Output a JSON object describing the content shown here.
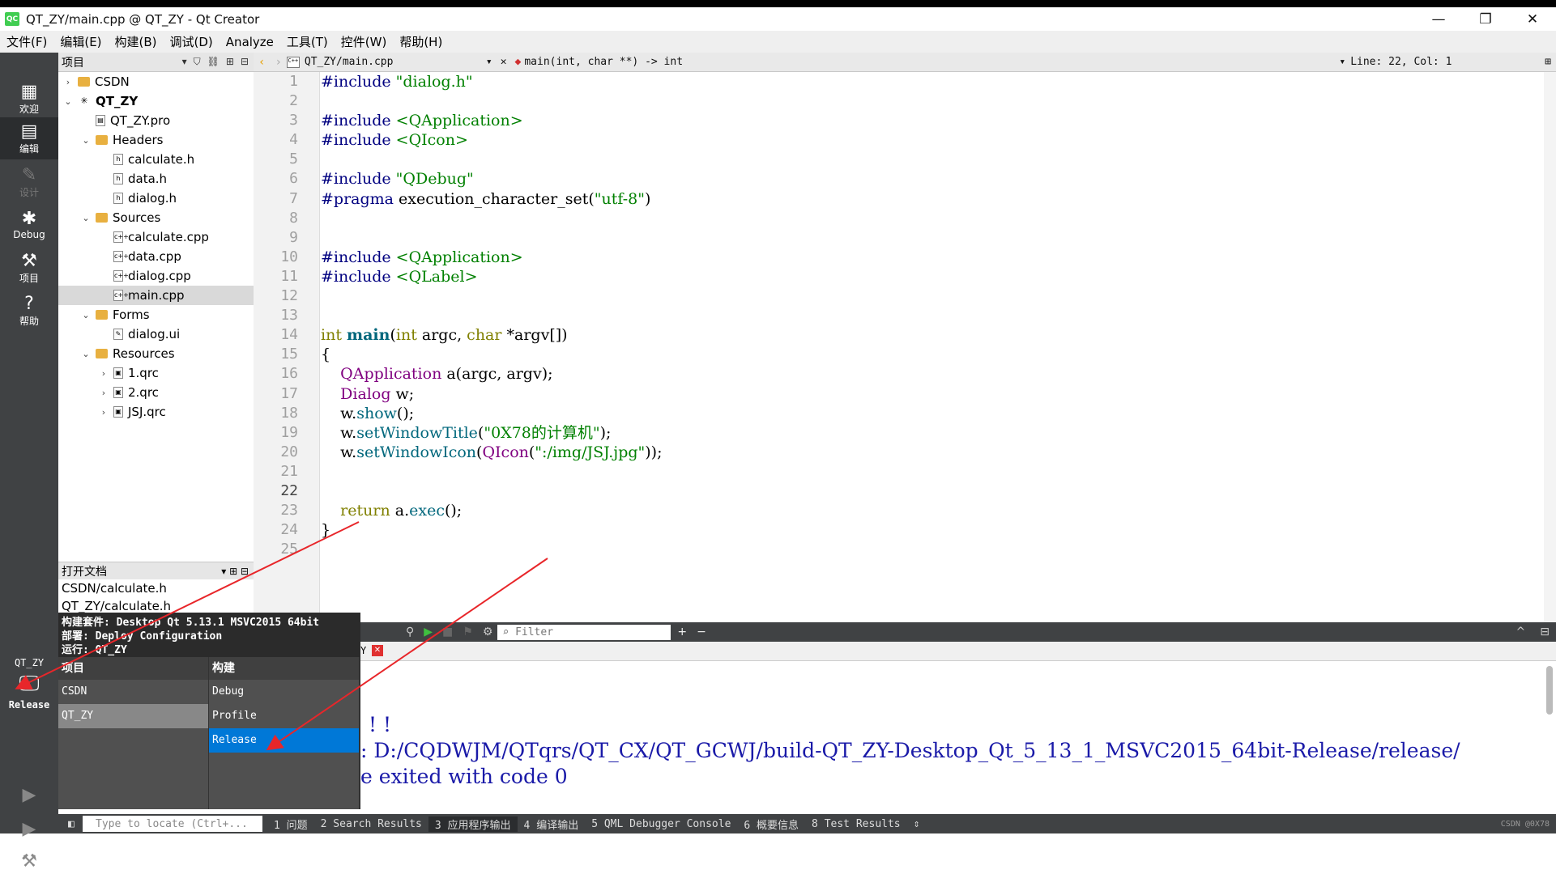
{
  "window": {
    "title": "QT_ZY/main.cpp @ QT_ZY - Qt Creator",
    "logo": "QC",
    "minimize": "—",
    "restore": "❐",
    "close": "✕"
  },
  "menu": [
    "文件(F)",
    "编辑(E)",
    "构建(B)",
    "调试(D)",
    "Analyze",
    "工具(T)",
    "控件(W)",
    "帮助(H)"
  ],
  "modes": [
    {
      "label": "欢迎",
      "icon": "grid-icon"
    },
    {
      "label": "编辑",
      "icon": "edit-icon"
    },
    {
      "label": "设计",
      "icon": "pencil-icon"
    },
    {
      "label": "Debug",
      "icon": "bug-icon"
    },
    {
      "label": "项目",
      "icon": "wrench-icon"
    },
    {
      "label": "帮助",
      "icon": "help-icon"
    }
  ],
  "project_panel": {
    "title": "项目",
    "tree": [
      {
        "label": "CSDN",
        "depth": 0,
        "twisty": "›"
      },
      {
        "label": "QT_ZY",
        "depth": 0,
        "twisty": "⌄",
        "bold": true
      },
      {
        "label": "QT_ZY.pro",
        "depth": 1,
        "twisty": ""
      },
      {
        "label": "Headers",
        "depth": 1,
        "twisty": "⌄"
      },
      {
        "label": "calculate.h",
        "depth": 2,
        "twisty": ""
      },
      {
        "label": "data.h",
        "depth": 2,
        "twisty": ""
      },
      {
        "label": "dialog.h",
        "depth": 2,
        "twisty": ""
      },
      {
        "label": "Sources",
        "depth": 1,
        "twisty": "⌄"
      },
      {
        "label": "calculate.cpp",
        "depth": 2,
        "twisty": ""
      },
      {
        "label": "data.cpp",
        "depth": 2,
        "twisty": ""
      },
      {
        "label": "dialog.cpp",
        "depth": 2,
        "twisty": ""
      },
      {
        "label": "main.cpp",
        "depth": 2,
        "twisty": "",
        "selected": true
      },
      {
        "label": "Forms",
        "depth": 1,
        "twisty": "⌄"
      },
      {
        "label": "dialog.ui",
        "depth": 2,
        "twisty": ""
      },
      {
        "label": "Resources",
        "depth": 1,
        "twisty": "⌄"
      },
      {
        "label": "1.qrc",
        "depth": 2,
        "twisty": "›"
      },
      {
        "label": "2.qrc",
        "depth": 2,
        "twisty": "›"
      },
      {
        "label": "JSJ.qrc",
        "depth": 2,
        "twisty": "›"
      }
    ]
  },
  "open_docs": {
    "title": "打开文档",
    "items": [
      "CSDN/calculate.h",
      "QT_ZY/calculate.h"
    ]
  },
  "editor": {
    "file": "QT_ZY/main.cpp",
    "symbol": "main(int, char **) -> int",
    "position": "Line: 22, Col: 1",
    "current_line": 22,
    "lines": [
      "#include \"dialog.h\"",
      "",
      "#include <QApplication>",
      "#include <QIcon>",
      "",
      "#include \"QDebug\"",
      "#pragma execution_character_set(\"utf-8\")",
      "",
      "",
      "#include <QApplication>",
      "#include <QLabel>",
      "",
      "",
      "int main(int argc, char *argv[])",
      "{",
      "    QApplication a(argc, argv);",
      "    Dialog w;",
      "    w.show();",
      "    w.setWindowTitle(\"0X78的计算机\");",
      "    w.setWindowIcon(QIcon(\":/img/JSJ.jpg\"));",
      "",
      "",
      "    return a.exec();",
      "}",
      ""
    ]
  },
  "output": {
    "filter_placeholder": "Filter",
    "tab_fragment": "Y",
    "line1": "! !",
    "line2": ": D:/CQDWJM/QTqrs/QT_CX/QT_GCWJ/build-QT_ZY-Desktop_Qt_5_13_1_MSVC2015_64bit-Release/release/",
    "line3": "e exited with code 0"
  },
  "kit_popup": {
    "info": [
      "构建套件: Desktop Qt 5.13.1 MSVC2015 64bit",
      "部署: Deploy Configuration",
      "运行: QT_ZY"
    ],
    "project_header": "项目",
    "build_header": "构建",
    "projects": [
      "CSDN",
      "QT_ZY"
    ],
    "builds": [
      "Debug",
      "Profile",
      "Release"
    ],
    "selected_project": "QT_ZY",
    "selected_build": "Release"
  },
  "kit_selector": {
    "project": "QT_ZY",
    "build": "Release"
  },
  "status": {
    "locate_placeholder": "Type to locate (Ctrl+...",
    "tabs": [
      "1 问题",
      "2 Search Results",
      "3 应用程序输出",
      "4 编译输出",
      "5 QML Debugger Console",
      "6 概要信息",
      "8 Test Results"
    ],
    "watermark": "CSDN @0X78"
  },
  "colors": {
    "sidebar": "#404244",
    "keyword": "#808000",
    "string": "#008000",
    "type": "#800080",
    "arrow": "#e8262a",
    "selection": "#0078d7"
  }
}
